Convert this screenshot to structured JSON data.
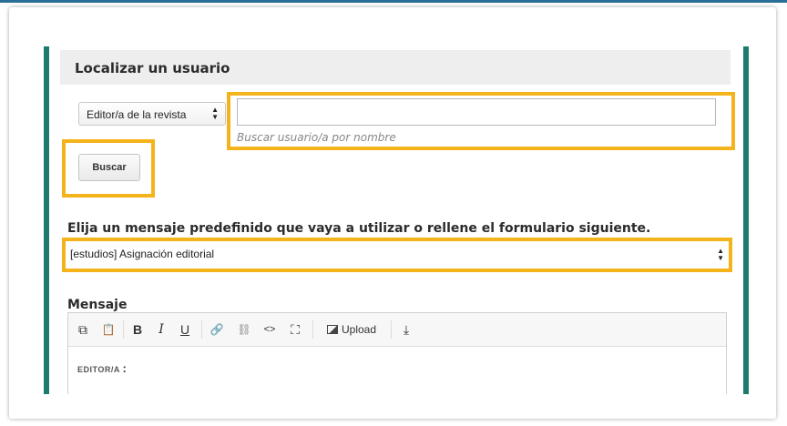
{
  "locate_user": {
    "title": "Localizar un usuario",
    "role_select_value": "Editor/a de la revista",
    "search_value": "",
    "search_help": "Buscar usuario/a por nombre",
    "search_button_label": "Buscar"
  },
  "template": {
    "heading": "Elija un mensaje predefinido que vaya a utilizar o rellene el formulario siguiente.",
    "selected_value": "[estudios] Asignación editorial"
  },
  "message": {
    "label": "Mensaje",
    "toolbar": {
      "copy_icon": "⧉",
      "paste_icon": "📋",
      "bold_label": "B",
      "italic_label": "I",
      "underline_label": "U",
      "link_icon": "🔗",
      "unlink_icon": "⛓",
      "code_icon": "<>",
      "fullscreen_icon": "⛶",
      "upload_label": "Upload",
      "insert_icon": "⤓"
    },
    "body_label": "EDITOR/A",
    "body_colon": ":"
  },
  "colors": {
    "highlight": "#f5b31b",
    "teal": "#1e7a6d"
  }
}
